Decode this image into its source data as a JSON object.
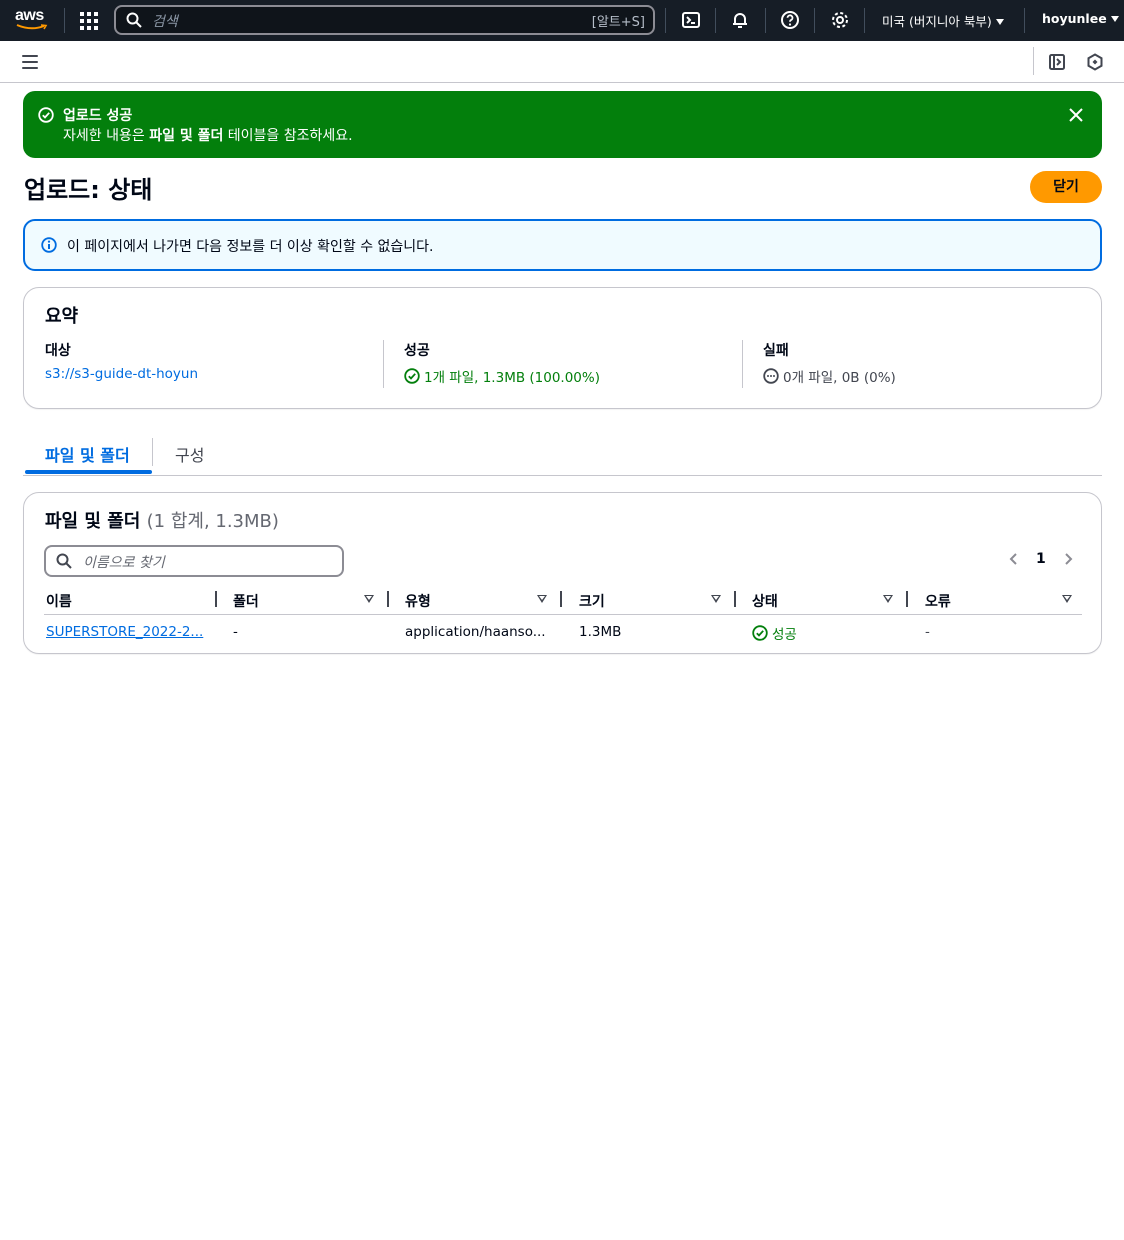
{
  "nav": {
    "logo": "aws",
    "search_placeholder": "검색",
    "search_shortcut": "[알트+S]",
    "region": "미국 (버지니아 북부)",
    "user": "hoyunlee"
  },
  "flash": {
    "title": "업로드 성공",
    "desc_prefix": "자세한 내용은 ",
    "desc_bold": "파일 및 폴더",
    "desc_suffix": " 테이블을 참조하세요."
  },
  "page": {
    "title": "업로드: 상태",
    "close_label": "닫기"
  },
  "info": {
    "text": "이 페이지에서 나가면 다음 정보를 더 이상 확인할 수 없습니다."
  },
  "summary": {
    "title": "요약",
    "target_label": "대상",
    "target_value": "s3://s3-guide-dt-hoyun",
    "success_label": "성공",
    "success_value": "1개 파일, 1.3MB (100.00%)",
    "failure_label": "실패",
    "failure_value": "0개 파일, 0B (0%)"
  },
  "tabs": [
    {
      "label": "파일 및 폴더",
      "active": true
    },
    {
      "label": "구성",
      "active": false
    }
  ],
  "files": {
    "title": "파일 및 폴더",
    "count": "(1 합계, 1.3MB)",
    "filter_placeholder": "이름으로 찾기",
    "page": "1",
    "columns": [
      "이름",
      "폴더",
      "유형",
      "크기",
      "상태",
      "오류"
    ],
    "rows": [
      {
        "name": "SUPERSTORE_2022-2...",
        "folder": "-",
        "type": "application/haanso...",
        "size": "1.3MB",
        "status": "성공",
        "error": "-"
      }
    ]
  },
  "colors": {
    "nav_bg": "#161d26",
    "success": "#037f0c",
    "accent": "#006ce0",
    "primary_button": "#ff9900",
    "info_bg": "#f0fbff"
  }
}
